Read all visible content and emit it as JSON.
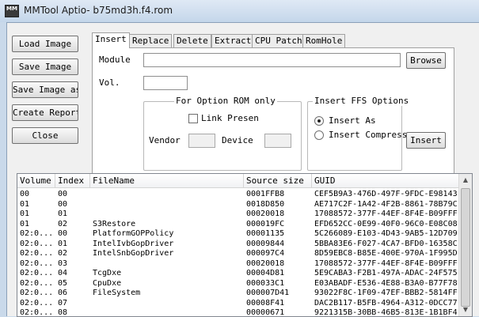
{
  "window": {
    "title": "MMTool Aptio- b75md3h.f4.rom",
    "icon": "MM"
  },
  "left_buttons": [
    {
      "label": "Load Image"
    },
    {
      "label": "Save Image"
    },
    {
      "label": "Save Image as.."
    },
    {
      "label": "Create Report"
    },
    {
      "label": "Close"
    }
  ],
  "tabs": [
    "Insert",
    "Replace",
    "Delete",
    "Extract",
    "CPU Patch",
    "RomHole"
  ],
  "insert": {
    "module_label": "Module",
    "module_value": "",
    "browse_label": "Browse",
    "vol_label": "Vol.",
    "vol_value": "",
    "option_rom": {
      "title": "For Option ROM only",
      "link_present_label": "Link Presen",
      "vendor_label": "Vendor",
      "device_label": "Device"
    },
    "ffs": {
      "title": "Insert FFS Options",
      "insert_as_label": "Insert As",
      "insert_compress_label": "Insert Compress",
      "selected": "Insert As"
    },
    "insert_button": "Insert"
  },
  "table": {
    "columns": [
      "Volume",
      "Index",
      "FileName",
      "Source size",
      "GUID"
    ],
    "rows": [
      [
        "00",
        "00",
        "",
        "0001FFB8",
        "CEF5B9A3-476D-497F-9FDC-E98143"
      ],
      [
        "01",
        "00",
        "",
        "0018D850",
        "AE717C2F-1A42-4F2B-8861-78B79C"
      ],
      [
        "01",
        "01",
        "",
        "00020018",
        "17088572-377F-44EF-8F4E-B09FFF"
      ],
      [
        "01",
        "02",
        "S3Restore",
        "000019FC",
        "EFD652CC-0E99-40F0-96C0-E08C08"
      ],
      [
        "02:0...",
        "00",
        "PlatformGOPPolicy",
        "00001135",
        "5C266089-E103-4D43-9AB5-12D709"
      ],
      [
        "02:0...",
        "01",
        "IntelIvbGopDriver",
        "00009844",
        "5BBA83E6-F027-4CA7-BFD0-16358C"
      ],
      [
        "02:0...",
        "02",
        "IntelSnbGopDriver",
        "000097C4",
        "8D59EBC8-B85E-400E-970A-1F995D"
      ],
      [
        "02:0...",
        "03",
        "",
        "00020018",
        "17088572-377F-44EF-8F4E-B09FFF"
      ],
      [
        "02:0...",
        "04",
        "TcgDxe",
        "00004D81",
        "5E9CABA3-F2B1-497A-ADAC-24F575"
      ],
      [
        "02:0...",
        "05",
        "CpuDxe",
        "000033C1",
        "E03ABADF-E536-4E88-B3A0-B77F78"
      ],
      [
        "02:0...",
        "06",
        "FileSystem",
        "000007D41",
        "93022F8C-1F09-47EF-BBB2-5814FF"
      ],
      [
        "02:0...",
        "07",
        "",
        "00008F41",
        "DAC2B117-B5FB-4964-A312-0DCC77"
      ],
      [
        "02:0...",
        "08",
        "",
        "00000671",
        "9221315B-30BB-46B5-813E-1B1BF4"
      ]
    ]
  },
  "icons": {
    "scroll_up": "scroll-up-arrow-icon",
    "scroll_down": "scroll-down-arrow-icon"
  }
}
